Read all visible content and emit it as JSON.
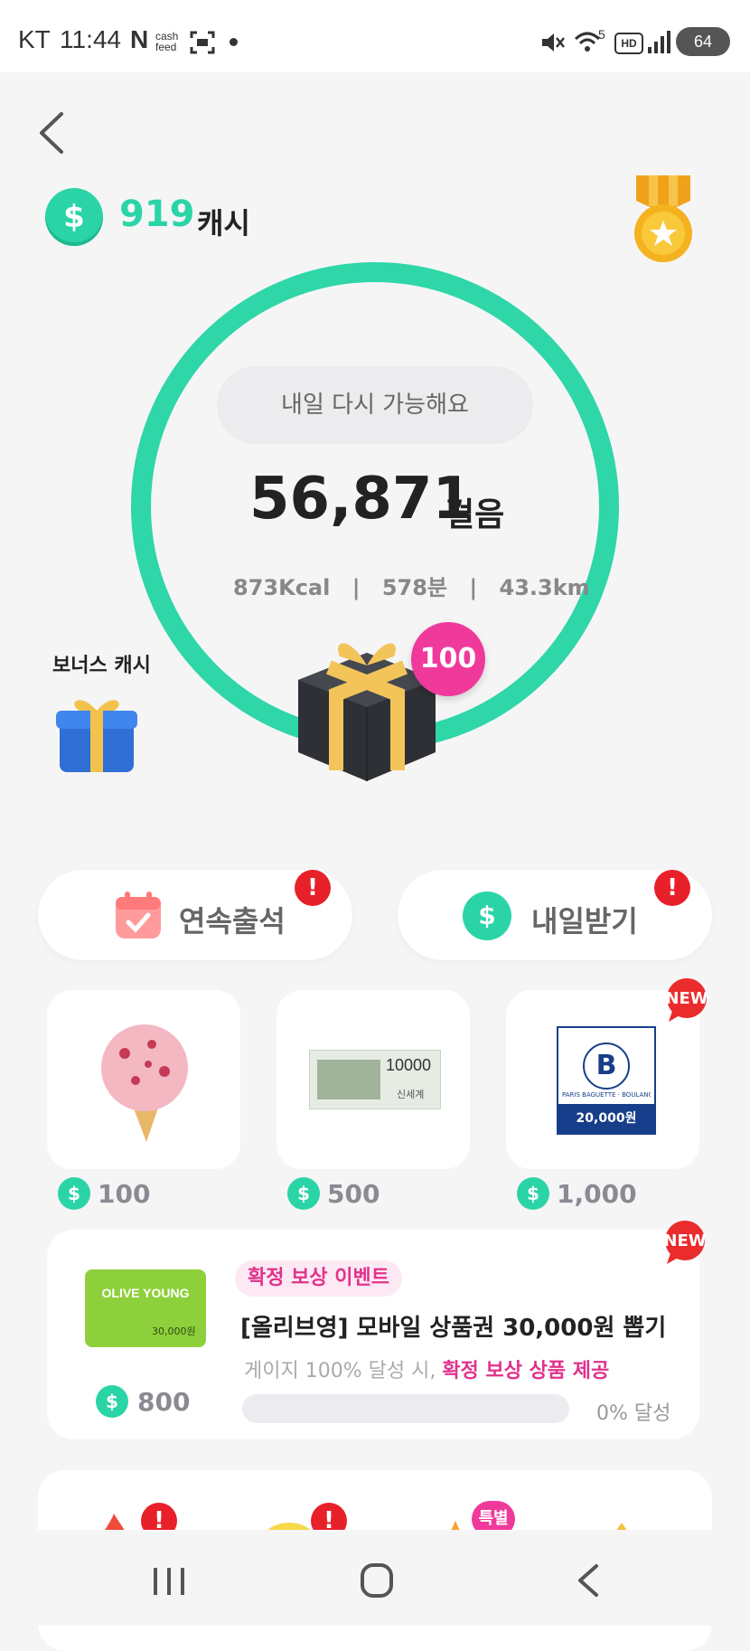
{
  "status_bar": {
    "carrier": "KT",
    "time": "11:44",
    "apps": [
      "N",
      "cash feed"
    ],
    "battery": "64",
    "network": "5",
    "hd": "HD",
    "icons": [
      "mute-icon",
      "wifi-icon",
      "hd-icon",
      "signal-icon",
      "battery-icon"
    ]
  },
  "header": {
    "cash_value": "919",
    "cash_unit": "캐시"
  },
  "tracker": {
    "status_text": "내일 다시 가능해요",
    "steps": "56,871",
    "steps_unit": "걸음",
    "kcal": "873Kcal",
    "minutes": "578분",
    "distance": "43.3km",
    "separator": "|",
    "reward_badge": "100",
    "ring_color": "#2ed6a8"
  },
  "bonus": {
    "label": "보너스 캐시"
  },
  "quick_actions": [
    {
      "label": "연속출석",
      "alert": "!"
    },
    {
      "label": "내일받기",
      "alert": "!"
    }
  ],
  "products": [
    {
      "price": "100",
      "new": false
    },
    {
      "price": "500",
      "new": false,
      "voucher_amount": "10000",
      "brand": "신세계"
    },
    {
      "price": "1,000",
      "new": true,
      "voucher_amount": "20,000원",
      "brand": "PARIS BAGUETTE · BOULANGERIE"
    }
  ],
  "new_label": "NEW",
  "coin_symbol": "$",
  "event": {
    "tag": "확정 보상 이벤트",
    "title": "[올리브영] 모바일 상품권 30,000원 뽑기",
    "sub_prefix": "게이지 100% 달성 시, ",
    "sub_highlight": "확정 보상 상품 제공",
    "progress_text": "0% 달성",
    "progress_value": 0,
    "price": "800",
    "card_brand": "OLIVE YOUNG",
    "card_amount": "30,000원",
    "new": true
  },
  "bottom_row": {
    "special_badge": "특별",
    "alerts": [
      "!",
      "!"
    ]
  },
  "colors": {
    "accent": "#2bd4a7",
    "pink": "#e0338c",
    "alert": "#e8202a"
  }
}
